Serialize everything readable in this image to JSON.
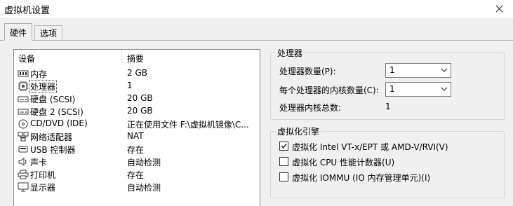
{
  "window": {
    "title": "虚拟机设置"
  },
  "tabs": [
    {
      "label": "硬件",
      "active": true
    },
    {
      "label": "选项",
      "active": false
    }
  ],
  "device_list": {
    "columns": {
      "device": "设备",
      "summary": "摘要"
    },
    "rows": [
      {
        "icon": "memory-icon",
        "name": "内存",
        "value": "2 GB"
      },
      {
        "icon": "cpu-icon",
        "name": "处理器",
        "value": "1",
        "selected": true
      },
      {
        "icon": "hard-disk-icon",
        "name": "硬盘 (SCSI)",
        "value": "20 GB"
      },
      {
        "icon": "hard-disk-icon",
        "name": "硬盘 2 (SCSI)",
        "value": "20 GB"
      },
      {
        "icon": "cd-dvd-icon",
        "name": "CD/DVD (IDE)",
        "value": "正在使用文件 F:\\虚拟机镜像\\C..."
      },
      {
        "icon": "network-adapter-icon",
        "name": "网络适配器",
        "value": "NAT"
      },
      {
        "icon": "usb-icon",
        "name": "USB 控制器",
        "value": "存在"
      },
      {
        "icon": "sound-card-icon",
        "name": "声卡",
        "value": "自动检测"
      },
      {
        "icon": "printer-icon",
        "name": "打印机",
        "value": "存在"
      },
      {
        "icon": "display-icon",
        "name": "显示器",
        "value": "自动检测"
      }
    ]
  },
  "processors": {
    "group_title": "处理器",
    "count_label": "处理器数量(P):",
    "count_value": "1",
    "cores_label": "每个处理器的内核数量(C):",
    "cores_value": "1",
    "total_label": "处理器内核总数:",
    "total_value": "1"
  },
  "virtualization": {
    "group_title": "虚拟化引擎",
    "options": [
      {
        "label": "虚拟化 Intel VT-x/EPT 或 AMD-V/RVI(V)",
        "checked": true
      },
      {
        "label": "虚拟化 CPU 性能计数器(U)",
        "checked": false
      },
      {
        "label": "虚拟化 IOMMU (IO 内存管理单元)(I)",
        "checked": false
      }
    ]
  }
}
